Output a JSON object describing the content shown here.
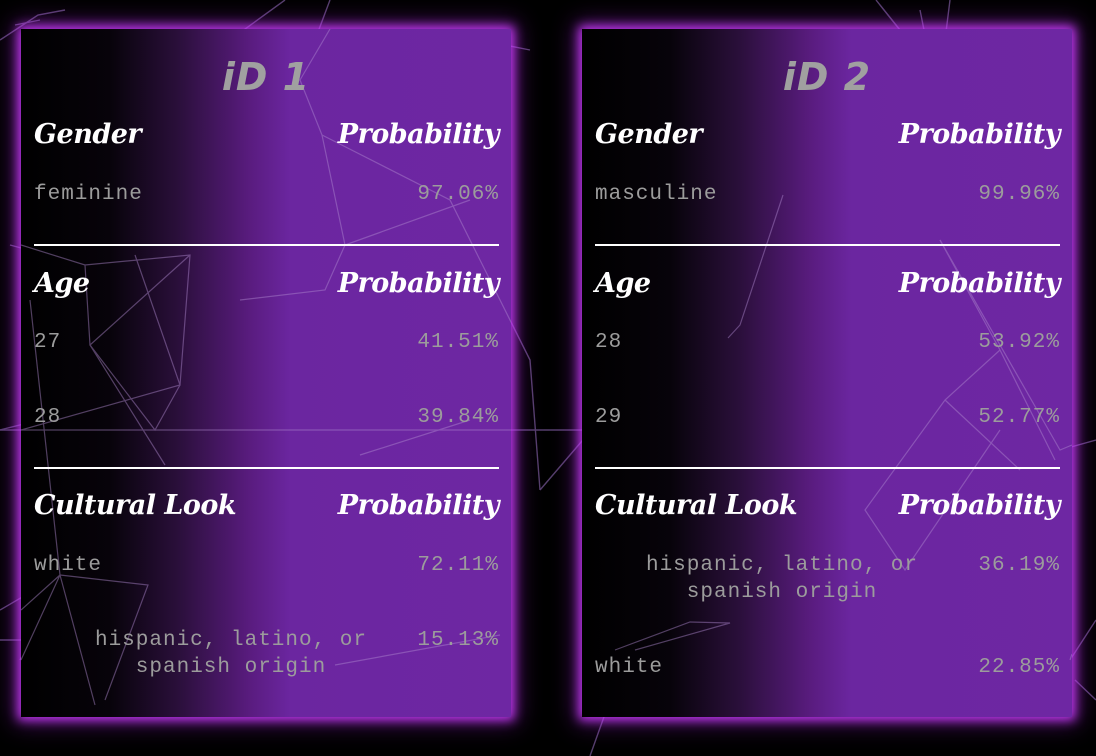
{
  "cards": [
    {
      "title": "iD 1",
      "gender": {
        "header": "Gender",
        "prob_header": "Probability",
        "rows": [
          {
            "label": "feminine",
            "prob": "97.06%"
          }
        ]
      },
      "age": {
        "header": "Age",
        "prob_header": "Probability",
        "rows": [
          {
            "label": "27",
            "prob": "41.51%"
          },
          {
            "label": "28",
            "prob": "39.84%"
          }
        ]
      },
      "culture": {
        "header": "Cultural Look",
        "prob_header": "Probability",
        "rows": [
          {
            "label": "white",
            "prob": "72.11%"
          },
          {
            "label": "hispanic, latino, or spanish origin",
            "prob": "15.13%"
          }
        ]
      }
    },
    {
      "title": "iD 2",
      "gender": {
        "header": "Gender",
        "prob_header": "Probability",
        "rows": [
          {
            "label": "masculine",
            "prob": "99.96%"
          }
        ]
      },
      "age": {
        "header": "Age",
        "prob_header": "Probability",
        "rows": [
          {
            "label": "28",
            "prob": "53.92%"
          },
          {
            "label": "29",
            "prob": "52.77%"
          }
        ]
      },
      "culture": {
        "header": "Cultural Look",
        "prob_header": "Probability",
        "rows": [
          {
            "label": "hispanic, latino, or spanish origin",
            "prob": "36.19%"
          },
          {
            "label": "white",
            "prob": "22.85%"
          }
        ]
      }
    }
  ],
  "colors": {
    "background": "#000000",
    "card_purple": "#6e27a3",
    "glow": "#cd3cff",
    "header_text": "#ffffff",
    "value_text": "#9c9c9c",
    "title_text": "#a0a0a0"
  }
}
